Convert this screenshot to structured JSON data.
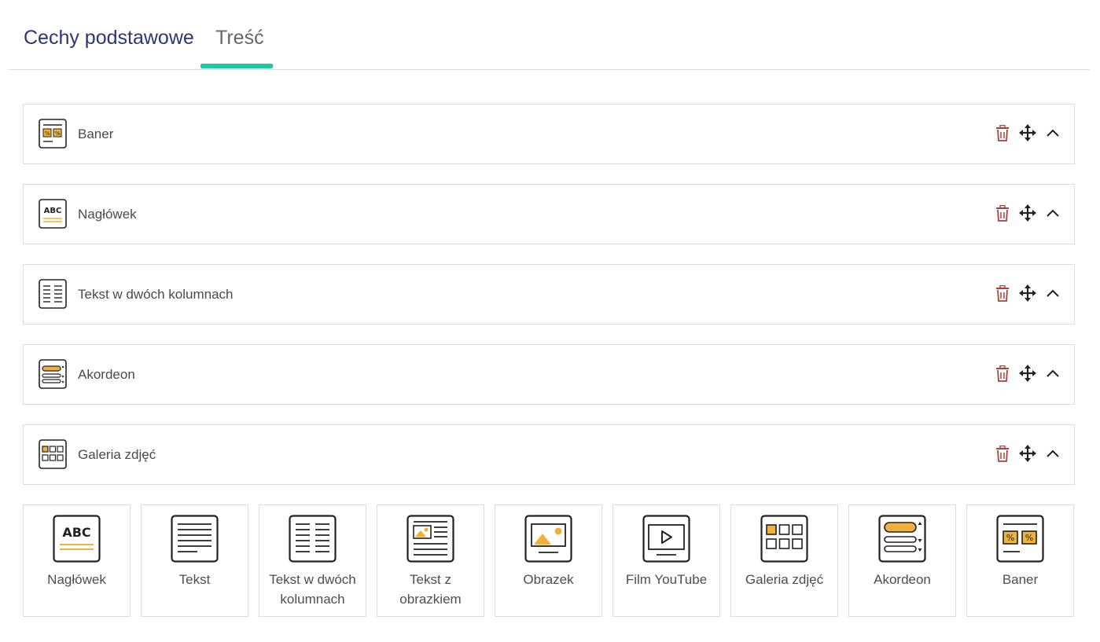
{
  "tabs": [
    {
      "label": "Cechy podstawowe",
      "active": false
    },
    {
      "label": "Treść",
      "active": true
    }
  ],
  "colors": {
    "accent": "#1dc9a0",
    "tab_text": "#2c3575",
    "icon_yellow": "#f0b13c",
    "delete_red": "#a9433e"
  },
  "blocks": [
    {
      "label": "Baner",
      "icon": "banner-icon"
    },
    {
      "label": "Nagłówek",
      "icon": "heading-icon"
    },
    {
      "label": "Tekst w dwóch kolumnach",
      "icon": "two-columns-icon"
    },
    {
      "label": "Akordeon",
      "icon": "accordion-icon"
    },
    {
      "label": "Galeria zdjęć",
      "icon": "gallery-icon"
    }
  ],
  "block_actions": [
    {
      "name": "delete",
      "icon": "trash-icon"
    },
    {
      "name": "move",
      "icon": "move-icon"
    },
    {
      "name": "collapse",
      "icon": "chevron-up-icon"
    }
  ],
  "add_tiles": [
    {
      "label": "Nagłówek",
      "icon": "heading-icon"
    },
    {
      "label": "Tekst",
      "icon": "text-icon"
    },
    {
      "label": "Tekst w dwóch kolumnach",
      "icon": "two-columns-icon"
    },
    {
      "label": "Tekst z obrazkiem",
      "icon": "text-with-image-icon"
    },
    {
      "label": "Obrazek",
      "icon": "image-icon"
    },
    {
      "label": "Film YouTube",
      "icon": "video-play-icon"
    },
    {
      "label": "Galeria zdjęć",
      "icon": "gallery-icon"
    },
    {
      "label": "Akordeon",
      "icon": "accordion-icon"
    },
    {
      "label": "Baner",
      "icon": "banner-icon"
    }
  ]
}
